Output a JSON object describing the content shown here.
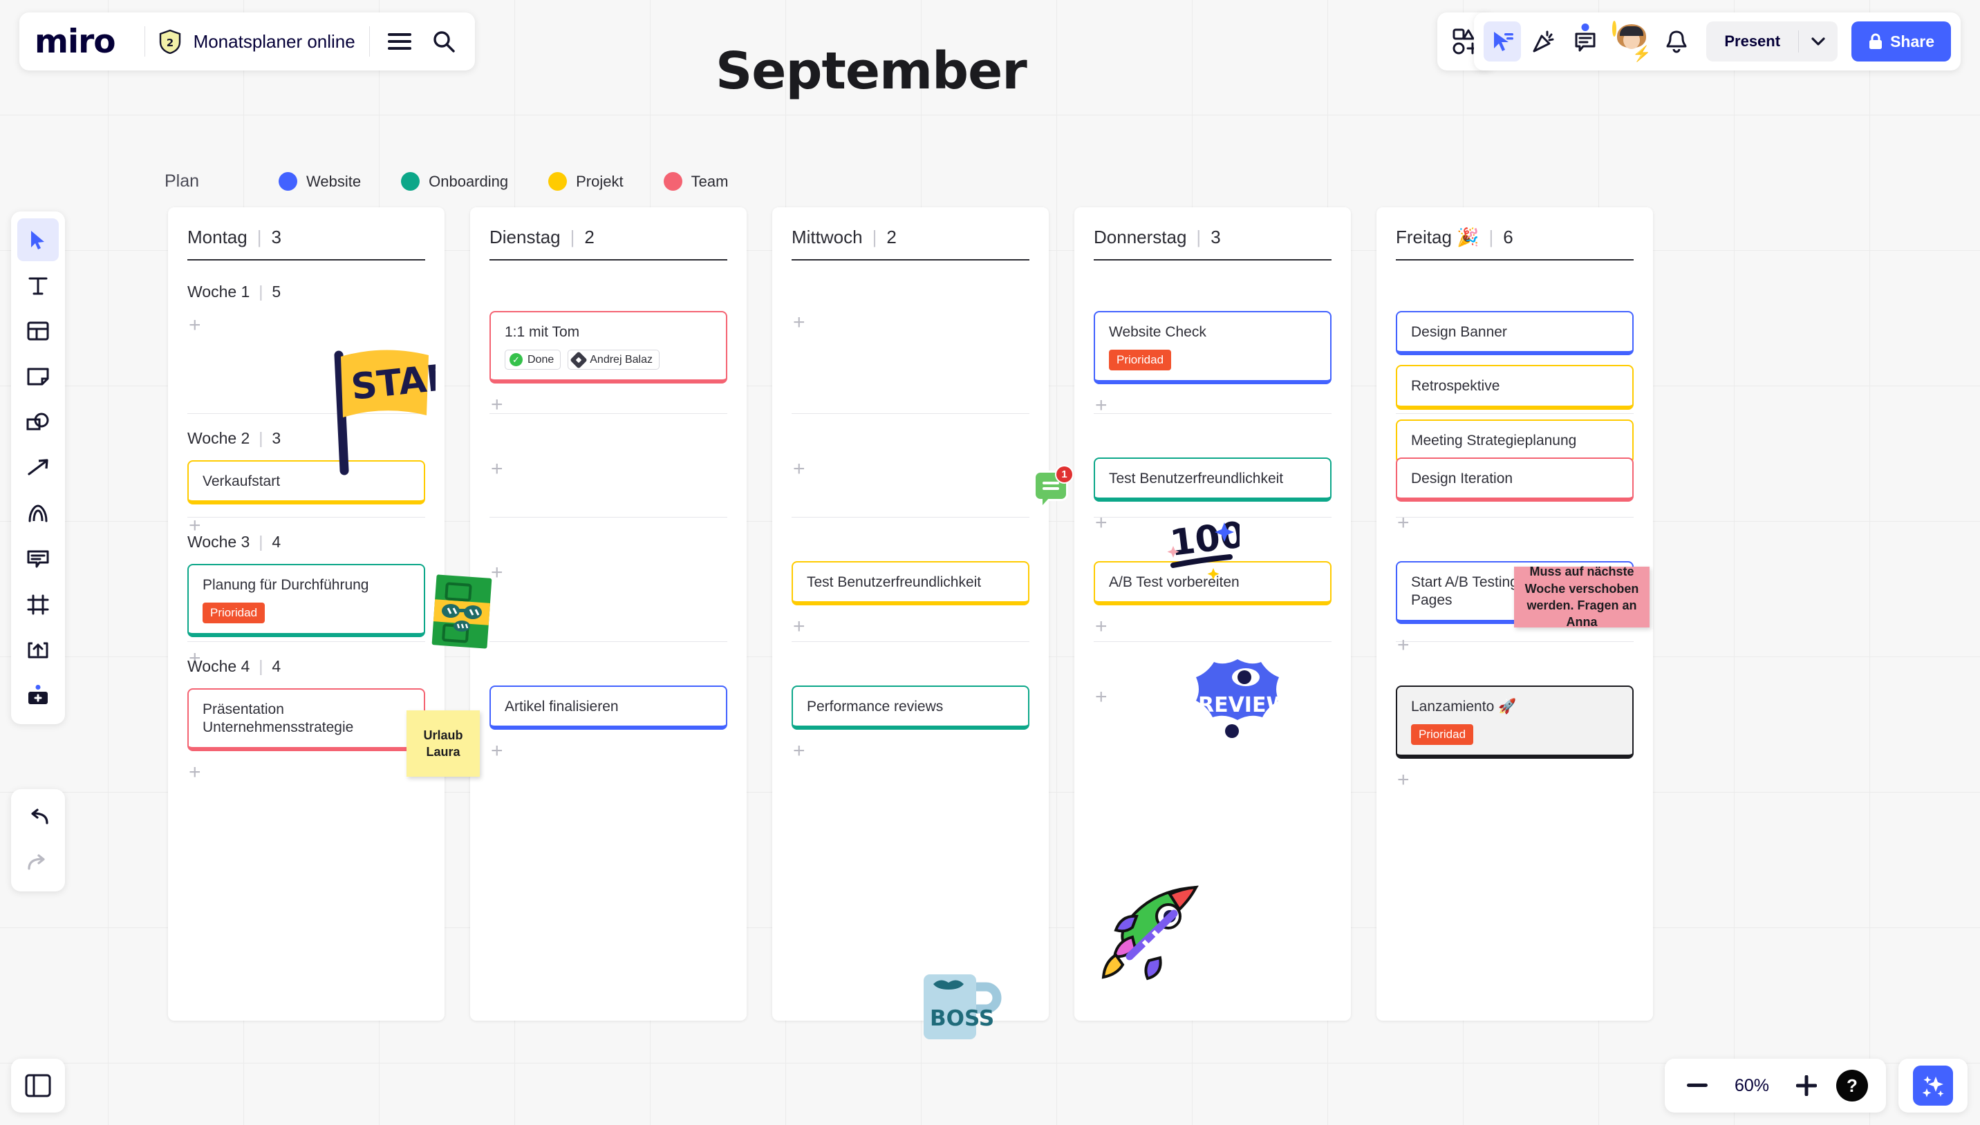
{
  "app": {
    "brand": "miro",
    "badge_count": "2",
    "board_title": "Monatsplaner online",
    "menu_icon": "hamburger-menu-icon",
    "search_icon": "search-icon"
  },
  "top_right": {
    "frames_icon": "frames-panel-icon",
    "select_icon": "cursor-select-icon",
    "celebrate_icon": "party-popper-icon",
    "comment_icon": "comment-icon",
    "avatar_name": "user-avatar",
    "bell_icon": "notification-bell-icon",
    "present_label": "Present",
    "caret_icon": "chevron-down-icon",
    "share_label": "Share",
    "share_icon": "lock-icon"
  },
  "left_toolbar": {
    "tools": [
      {
        "name": "cursor-select-tool",
        "active": true
      },
      {
        "name": "text-tool",
        "active": false
      },
      {
        "name": "templates-tool",
        "active": false
      },
      {
        "name": "sticky-note-tool",
        "active": false
      },
      {
        "name": "shapes-tool",
        "active": false
      },
      {
        "name": "connection-line-tool",
        "active": false
      },
      {
        "name": "pen-tool",
        "active": false
      },
      {
        "name": "comment-tool",
        "active": false
      },
      {
        "name": "frame-tool",
        "active": false
      },
      {
        "name": "upload-tool",
        "active": false
      },
      {
        "name": "apps-more-tool",
        "active": false
      }
    ],
    "undo_icon": "undo-icon",
    "redo_icon": "redo-icon",
    "panel_toggle_icon": "side-panel-toggle-icon"
  },
  "bottom_bar": {
    "zoom_out_icon": "minus-icon",
    "zoom_level": "60%",
    "zoom_in_icon": "plus-icon",
    "help_label": "?",
    "ai_icon": "ai-sparkles-icon"
  },
  "board": {
    "month_title": "September",
    "legend": {
      "label": "Plan",
      "items": [
        {
          "label": "Website",
          "color": "#4262ff"
        },
        {
          "label": "Onboarding",
          "color": "#0ca789"
        },
        {
          "label": "Projekt",
          "color": "#ffcb00"
        },
        {
          "label": "Team",
          "color": "#f46372"
        }
      ]
    },
    "columns": [
      {
        "day": "Montag",
        "count": "3",
        "weeks": [
          {
            "label": "Woche 1",
            "count": "5",
            "cards": []
          },
          {
            "label": "Woche 2",
            "count": "3",
            "cards": [
              {
                "title": "Verkaufstart",
                "color": "b-yellow",
                "tag": ""
              }
            ]
          },
          {
            "label": "Woche 3",
            "count": "4",
            "cards": [
              {
                "title": "Planung für Durchführung",
                "color": "b-green",
                "tag": "Prioridad"
              }
            ]
          },
          {
            "label": "Woche 4",
            "count": "4",
            "cards": [
              {
                "title": "Präsentation Unternehmensstrategie",
                "color": "b-pink",
                "tag": ""
              }
            ]
          }
        ]
      },
      {
        "day": "Dienstag",
        "count": "2",
        "weeks": [
          {
            "label": "",
            "count": "",
            "cards": [
              {
                "title": "1:1 mit Tom",
                "color": "b-pink",
                "tag": "",
                "chips": [
                  "Done",
                  "Andrej Balaz"
                ]
              }
            ]
          },
          {
            "label": "",
            "count": "",
            "cards": []
          },
          {
            "label": "",
            "count": "",
            "cards": []
          },
          {
            "label": "",
            "count": "",
            "cards": [
              {
                "title": "Artikel finalisieren",
                "color": "b-blue",
                "tag": ""
              }
            ]
          }
        ]
      },
      {
        "day": "Mittwoch",
        "count": "2",
        "weeks": [
          {
            "label": "",
            "count": "",
            "cards": []
          },
          {
            "label": "",
            "count": "",
            "cards": []
          },
          {
            "label": "",
            "count": "",
            "cards": [
              {
                "title": "Test Benutzerfreundlichkeit",
                "color": "b-yellow",
                "tag": ""
              }
            ]
          },
          {
            "label": "",
            "count": "",
            "cards": [
              {
                "title": "Performance reviews",
                "color": "b-green",
                "tag": ""
              }
            ]
          }
        ]
      },
      {
        "day": "Donnerstag",
        "count": "3",
        "weeks": [
          {
            "label": "",
            "count": "",
            "cards": [
              {
                "title": "Website Check",
                "color": "b-blue",
                "tag": "Prioridad"
              }
            ]
          },
          {
            "label": "",
            "count": "",
            "cards": [
              {
                "title": "Test Benutzerfreundlichkeit",
                "color": "b-green",
                "tag": ""
              }
            ]
          },
          {
            "label": "",
            "count": "",
            "cards": [
              {
                "title": "A/B Test vorbereiten",
                "color": "b-yellow",
                "tag": ""
              }
            ]
          },
          {
            "label": "",
            "count": "",
            "cards": []
          }
        ]
      },
      {
        "day": "Freitag 🎉",
        "count": "6",
        "weeks": [
          {
            "label": "",
            "count": "",
            "cards": [
              {
                "title": "Design Banner",
                "color": "b-blue",
                "tag": ""
              },
              {
                "title": "Retrospektive",
                "color": "b-yellow",
                "tag": ""
              },
              {
                "title": "Meeting Strategieplanung",
                "color": "b-yellow",
                "tag": ""
              }
            ]
          },
          {
            "label": "",
            "count": "",
            "cards": [
              {
                "title": "Design Iteration",
                "color": "b-pink",
                "tag": ""
              }
            ]
          },
          {
            "label": "",
            "count": "",
            "cards": [
              {
                "title": "Start A/B Testing für Landing Pages",
                "color": "b-blue",
                "tag": ""
              }
            ]
          },
          {
            "label": "",
            "count": "",
            "cards": [
              {
                "title": "Lanzamiento 🚀",
                "color": "b-dark",
                "tag": "Prioridad"
              }
            ]
          }
        ]
      }
    ],
    "add_label": "+",
    "stickers": [
      {
        "name": "start-flag-sticker",
        "label": "START"
      },
      {
        "name": "money-cash-sticker",
        "label": ""
      },
      {
        "name": "hundred-points-sticker",
        "label": "100"
      },
      {
        "name": "review-eyes-sticker",
        "label": "REVIEW"
      },
      {
        "name": "boss-mug-sticker",
        "label": "BOSS"
      },
      {
        "name": "rocket-sticker",
        "label": ""
      }
    ],
    "notes": [
      {
        "name": "sticky-note-urlaub",
        "text": "Urlaub Laura",
        "color": "yellow"
      },
      {
        "name": "sticky-note-verschoben",
        "text": "Muss auf nächste Woche verschoben werden. Fragen an Anna",
        "color": "pink"
      }
    ],
    "comment_pin": {
      "count": "1"
    }
  }
}
